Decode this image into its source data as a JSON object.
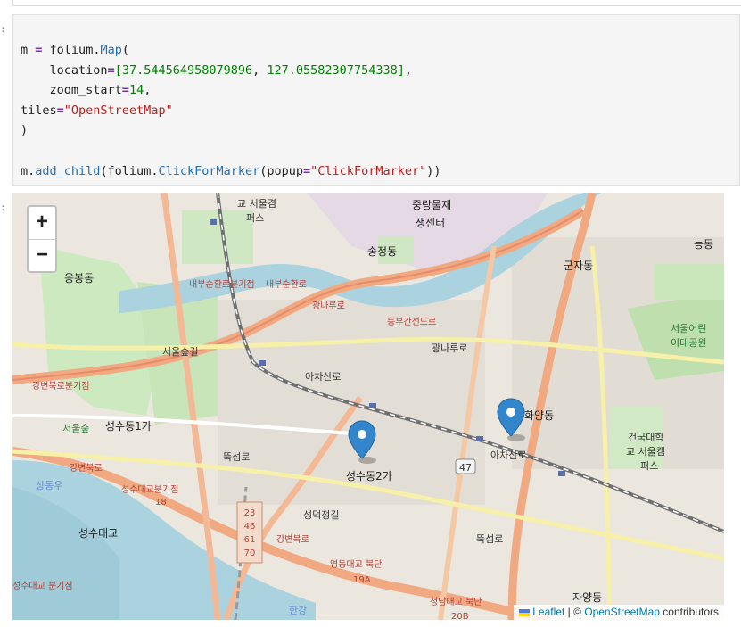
{
  "prompts": {
    "code": ":",
    "output": ":"
  },
  "code": {
    "line1": {
      "var": "m",
      "eq": "=",
      "obj": " folium.",
      "cls": "Map",
      "paren": "("
    },
    "line2": {
      "indent": "    location",
      "eq": "=",
      "open": "[",
      "lat": "37.544564958079896",
      "comma": ", ",
      "lon": "127.05582307754338",
      "close": "]",
      "end": ","
    },
    "line3": {
      "indent": "    zoom_start",
      "eq": "=",
      "zoom": "14",
      "end": ","
    },
    "line4": {
      "key": "tiles",
      "eq": "=",
      "tiles": "\"OpenStreetMap\""
    },
    "line5": ")",
    "line7": {
      "pre": "m.",
      "fn1": "add_child",
      "mid": "(folium.",
      "fn2": "ClickForMarker",
      "arg": "(popup",
      "eq": "=",
      "str": "\"ClickForMarker\"",
      "close": "))"
    }
  },
  "map": {
    "zoom_in": "+",
    "zoom_out": "−",
    "attribution": {
      "leaflet": "Leaflet",
      "sep": " | © ",
      "osm": "OpenStreetMap",
      "tail": " contributors"
    },
    "labels": {
      "jungnang_market": "중랑물재",
      "jungnang_center": "생센터",
      "songjeong": "송정동",
      "seoulgyeong": "교 서울겸",
      "pieseu": "퍼스",
      "eungbong": "응봉동",
      "seoulsup": "서울숲길",
      "seoulsup2": "서울숲",
      "seongsu1": "성수동1가",
      "seongsu2": "성수동2가",
      "hwayang": "화양동",
      "gunja": "군자동",
      "neung": "능동",
      "childrens_park": "서울어린",
      "childrens_park2": "이대공원",
      "konkuk1": "건국대학",
      "konkuk2": "교 서울캠",
      "konkuk3": "퍼스",
      "jayang": "자양동",
      "seongsu_bridge": "성수대교",
      "seongdeok": "성덕정길",
      "naebu_ramp": "내부순환로분기점",
      "gangbyeon_ramp": "강변북로분기점",
      "seongsu_ramp": "성수대교분기점",
      "seongsu_ramp_bottom": "성수대교 분기점",
      "yeongdong_ramp": "영동대교 북단",
      "cheongdam_ramp": "청담대교 북단",
      "naebu": "내부순환로",
      "dongbu": "동부간선도로",
      "gwangnaru": "광나루로",
      "achasan": "아차산로",
      "ttukseom": "뚝섬로",
      "gangbyeon": "강변북로",
      "hangang": "한강",
      "yeongdong_num": "19A",
      "road_20b": "20B",
      "road_18": "18",
      "route_47": "47",
      "bus1": "23",
      "bus2": "46",
      "bus3": "61",
      "bus4": "70",
      "river_name": "상동우"
    }
  }
}
